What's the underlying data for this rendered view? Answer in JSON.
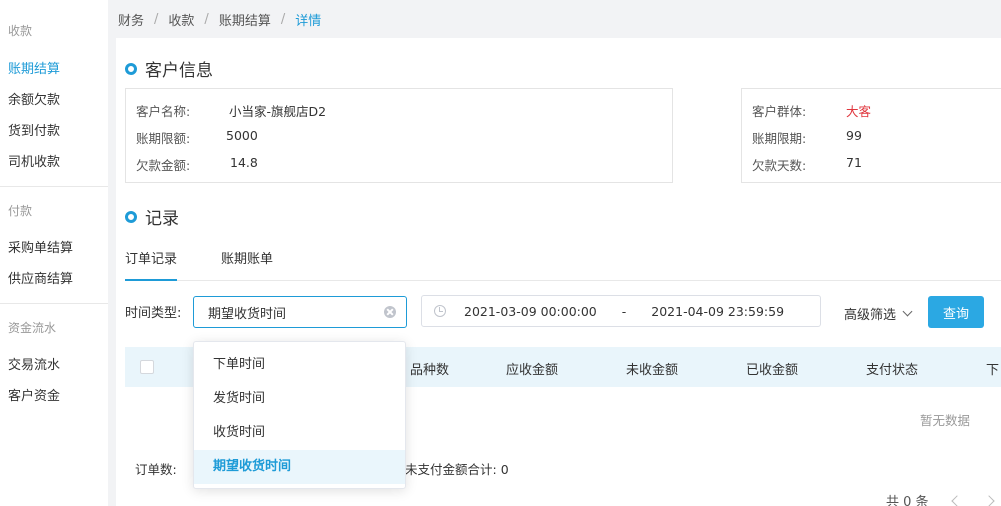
{
  "sidebar": {
    "groups": [
      {
        "title": "收款",
        "items": [
          "账期结算",
          "余额欠款",
          "货到付款",
          "司机收款"
        ]
      },
      {
        "title": "付款",
        "items": [
          "采购单结算",
          "供应商结算"
        ]
      },
      {
        "title": "资金流水",
        "items": [
          "交易流水",
          "客户资金"
        ]
      }
    ]
  },
  "breadcrumb": [
    "财务",
    "收款",
    "账期结算",
    "详情"
  ],
  "customer_section": {
    "title": "客户信息",
    "left": [
      {
        "label": "客户名称:",
        "value": "小当家-旗舰店D2"
      },
      {
        "label": "账期限额:",
        "value": "5000"
      },
      {
        "label": "欠款金额:",
        "value": "14.8"
      }
    ],
    "right": [
      {
        "label": "客户群体:",
        "value": "大客"
      },
      {
        "label": "账期限期:",
        "value": "99"
      },
      {
        "label": "欠款天数:",
        "value": "71"
      }
    ],
    "highlight_color": "#e0363d"
  },
  "records_section": {
    "title": "记录",
    "tabs": [
      "订单记录",
      "账期账单"
    ]
  },
  "filters": {
    "time_type_label": "时间类型:",
    "time_type_value": "期望收货时间",
    "date_start": "2021-03-09 00:00:00",
    "date_sep": "-",
    "date_end": "2021-04-09 23:59:59",
    "advanced_label": "高级筛选",
    "query_button": "查询"
  },
  "table": {
    "columns": [
      "品种数",
      "应收金额",
      "未收金额",
      "已收金额",
      "支付状态",
      "下"
    ],
    "empty_text": "暂无数据"
  },
  "summary": {
    "order_count_label": "订单数:",
    "unpaid_total_label": "未支付金额合计:",
    "unpaid_total_value": "0"
  },
  "pager": {
    "total_text": "共 0 条"
  },
  "dropdown": {
    "options": [
      "下单时间",
      "发货时间",
      "收货时间",
      "期望收货时间"
    ],
    "selected": "期望收货时间"
  },
  "colors": {
    "accent": "#1e9bd7",
    "button": "#2ba8e3"
  }
}
